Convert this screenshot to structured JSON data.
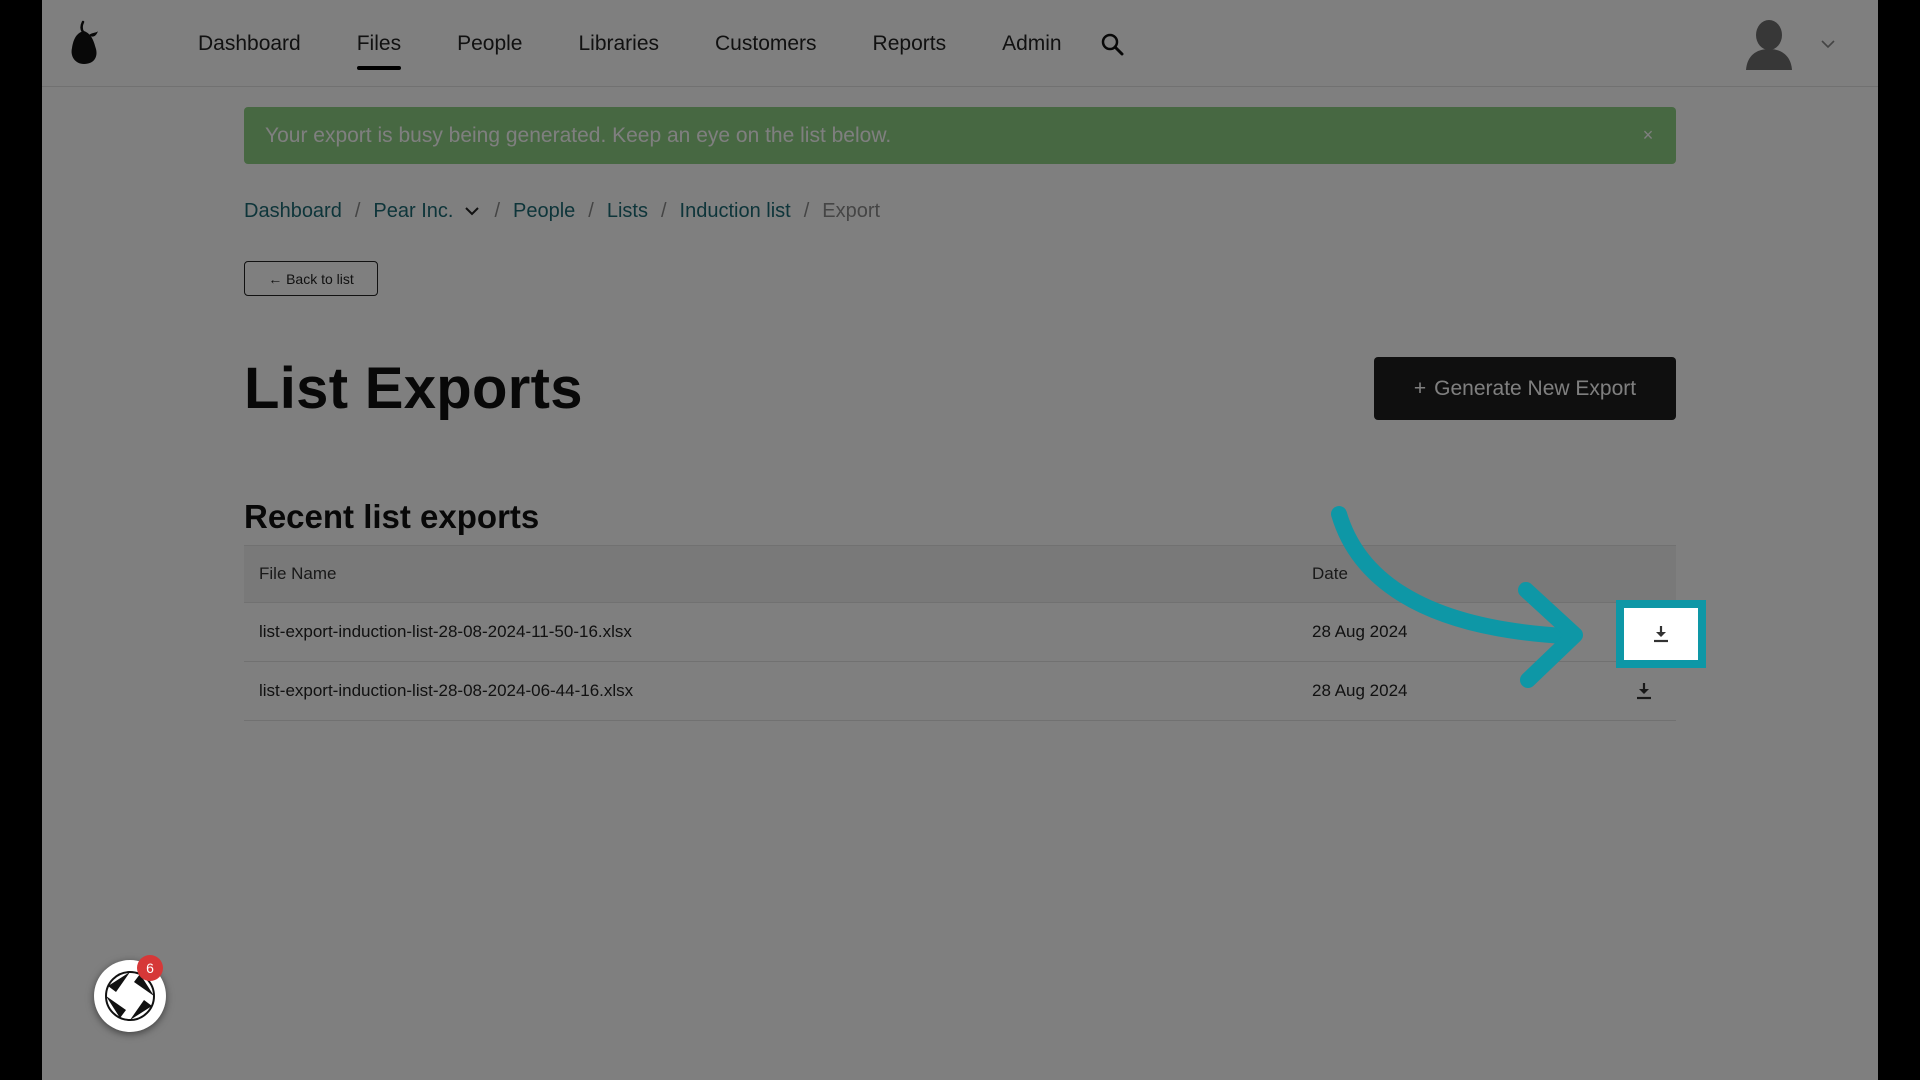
{
  "nav": {
    "items": [
      {
        "label": "Dashboard",
        "active": false
      },
      {
        "label": "Files",
        "active": true
      },
      {
        "label": "People",
        "active": false
      },
      {
        "label": "Libraries",
        "active": false
      },
      {
        "label": "Customers",
        "active": false
      },
      {
        "label": "Reports",
        "active": false
      },
      {
        "label": "Admin",
        "active": false
      }
    ]
  },
  "alert": {
    "message": "Your export is busy being generated. Keep an eye on the list below.",
    "close": "×"
  },
  "breadcrumb": {
    "items": [
      "Dashboard",
      "Pear Inc.",
      "People",
      "Lists",
      "Induction list"
    ],
    "current": "Export",
    "separator": "/"
  },
  "back_button": "← Back to list",
  "page_title": "List Exports",
  "generate_button": {
    "plus": "+",
    "label": "Generate New Export"
  },
  "table": {
    "title": "Recent list exports",
    "columns": [
      "File Name",
      "Date"
    ],
    "rows": [
      {
        "file": "list-export-induction-list-28-08-2024-11-50-16.xlsx",
        "date": "28 Aug 2024"
      },
      {
        "file": "list-export-induction-list-28-08-2024-06-44-16.xlsx",
        "date": "28 Aug 2024"
      }
    ]
  },
  "widget": {
    "badge_count": "6"
  },
  "colors": {
    "accent": "#0e97a6",
    "alert_bg": "#8fd085",
    "link": "#1d6a75",
    "badge": "#d63838",
    "primary_button": "#1f1f1f"
  },
  "icons": [
    "pear-logo-icon",
    "search-icon",
    "avatar-icon",
    "chevron-down-icon",
    "close-icon",
    "download-icon",
    "widget-logo-icon",
    "curved-arrow-icon"
  ]
}
